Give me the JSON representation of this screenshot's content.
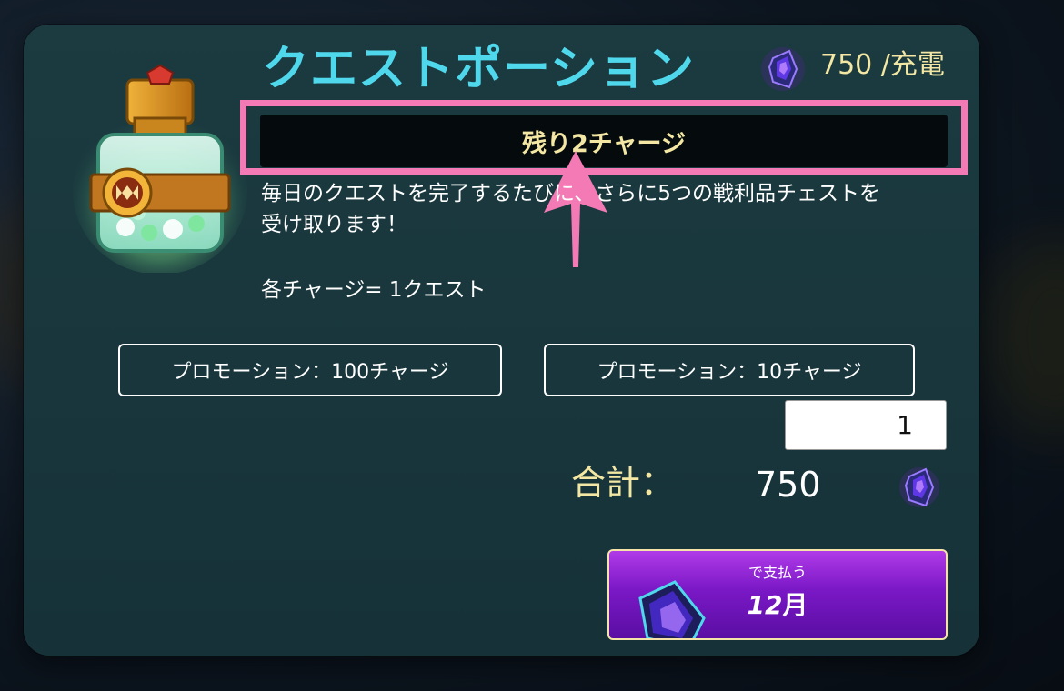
{
  "item": {
    "title": "クエストポーション",
    "icon": "quest-potion-icon"
  },
  "price": {
    "amount_label": "750 /充電",
    "currency_icon": "gem-icon"
  },
  "charges": {
    "remaining_label": "残り2チャージ"
  },
  "description": {
    "line1": "毎日のクエストを完了するたびに、さらに5つの戦利品チェストを",
    "line2": "受け取ります！",
    "charge_equivalence": "各チャージ= 1クエスト"
  },
  "promotions": [
    {
      "label": "プロモーション：100チャージ"
    },
    {
      "label": "プロモーション：10チャージ"
    }
  ],
  "quantity": {
    "value": "1"
  },
  "total": {
    "label": "合計：",
    "value": "750"
  },
  "pay_button": {
    "sub_label": "で支払う",
    "main_number": "12",
    "main_unit": "月"
  },
  "colors": {
    "title": "#4fd8ec",
    "accent_text": "#f3e7a3",
    "highlight": "#f47ab6",
    "pay_button": "#7a18c6",
    "panel": "#1b3b41"
  }
}
